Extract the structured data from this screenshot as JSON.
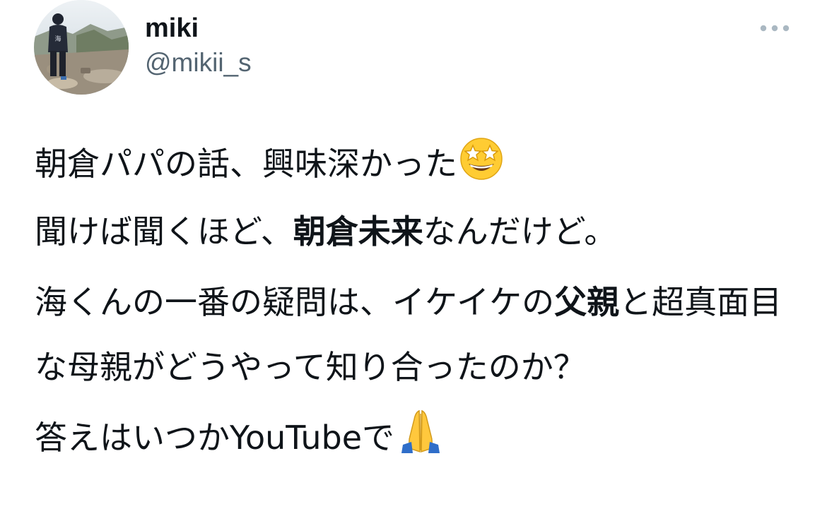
{
  "user": {
    "display_name": "miki",
    "handle": "@mikii_s"
  },
  "actions": {
    "more_icon": "more-horizontal-icon"
  },
  "tweet": {
    "p1": {
      "line1_text": "朝倉パパの話、興味深かった",
      "line1_emoji": "star-struck-emoji",
      "line2_a": "聞けば聞くほど、",
      "line2_bold": "朝倉未来",
      "line2_b": "なんだけど。"
    },
    "p2": {
      "text_a": "海くんの一番の疑問は、イケイケの",
      "text_bold": "父親",
      "text_b": "と超真面目な母親がどうやって知り合ったのか？"
    },
    "p3": {
      "text": "答えはいつかYouTubeで",
      "emoji": "folded-hands-emoji"
    }
  },
  "colors": {
    "text_primary": "#0f1419",
    "text_secondary": "#536471",
    "icon_gray": "#aab8c2"
  }
}
